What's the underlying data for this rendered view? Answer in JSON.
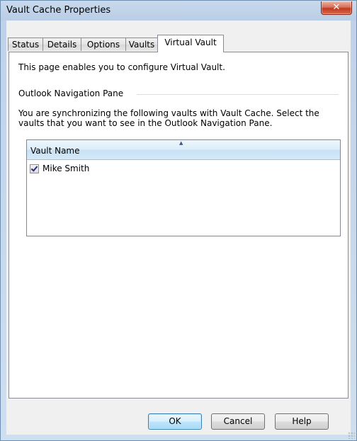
{
  "window": {
    "title": "Vault Cache Properties",
    "close_symbol": "✕"
  },
  "tabs": [
    {
      "label": "Status",
      "active": false
    },
    {
      "label": "Details",
      "active": false
    },
    {
      "label": "Options",
      "active": false
    },
    {
      "label": "Vaults",
      "active": false
    },
    {
      "label": "Virtual Vault",
      "active": true
    }
  ],
  "page": {
    "intro": "This page enables you to configure Virtual Vault.",
    "group_label": "Outlook Navigation Pane",
    "description": "You are synchronizing the following vaults with Vault Cache. Select the vaults that you want to see in the Outlook Navigation Pane.",
    "list": {
      "column_header": "Vault Name",
      "sort_indicator": "▲",
      "rows": [
        {
          "label": "Mike Smith",
          "checked": true
        }
      ]
    }
  },
  "buttons": {
    "ok": "OK",
    "cancel": "Cancel",
    "help": "Help"
  }
}
